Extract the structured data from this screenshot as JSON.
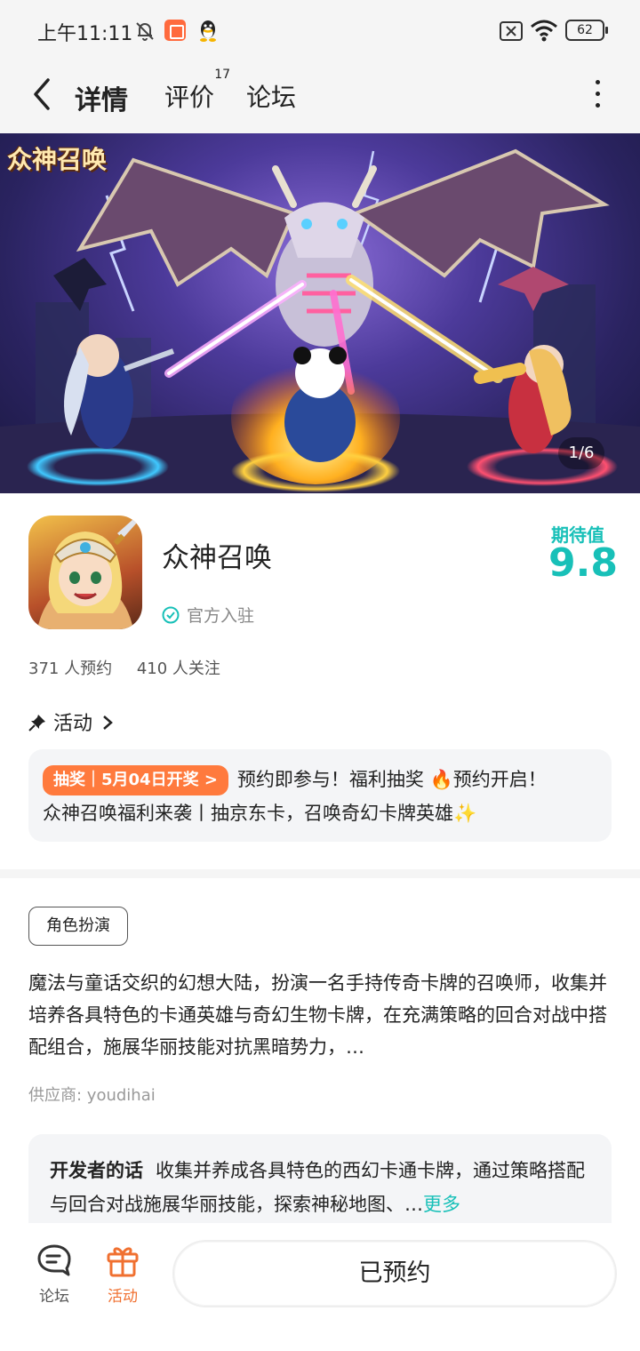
{
  "status_bar": {
    "time": "上午11:11",
    "battery": "62"
  },
  "header": {
    "tabs": [
      {
        "label": "详情",
        "active": true
      },
      {
        "label": "评价",
        "badge": "17"
      },
      {
        "label": "论坛"
      }
    ]
  },
  "banner": {
    "logo_text": "众神召唤",
    "counter": "1/6"
  },
  "app": {
    "name": "众神召唤",
    "official": "官方入驻",
    "score_label": "期待值",
    "score": "9.8",
    "reservations": "371 人预约",
    "followers": "410 人关注"
  },
  "activity": {
    "title": "活动",
    "tag": "抽奖｜5月04日开奖 >",
    "line1": "预约即参与！福利抽奖 🔥预约开启！",
    "line2": "众神召唤福利来袭丨抽京东卡，召唤奇幻卡牌英雄✨"
  },
  "info": {
    "genre": "角色扮演",
    "description": "魔法与童话交织的幻想大陆，扮演一名手持传奇卡牌的召唤师，收集并培养各具特色的卡通英雄与奇幻生物卡牌，在充满策略的回合对战中搭配组合，施展华丽技能对抗黑暗势力，…",
    "supplier": "供应商: youdihai",
    "dev_label": "开发者的话",
    "dev_text": "收集并养成各具特色的西幻卡通卡牌，通过策略搭配与回合对战施展华丽技能，探索神秘地图、…",
    "dev_more": "更多"
  },
  "bottom_bar": {
    "forum_label": "论坛",
    "activity_label": "活动",
    "reserve_button": "已预约"
  },
  "colors": {
    "accent": "#18c0b8",
    "orange": "#f07030",
    "lottery_tag": "#ff7a3d"
  }
}
